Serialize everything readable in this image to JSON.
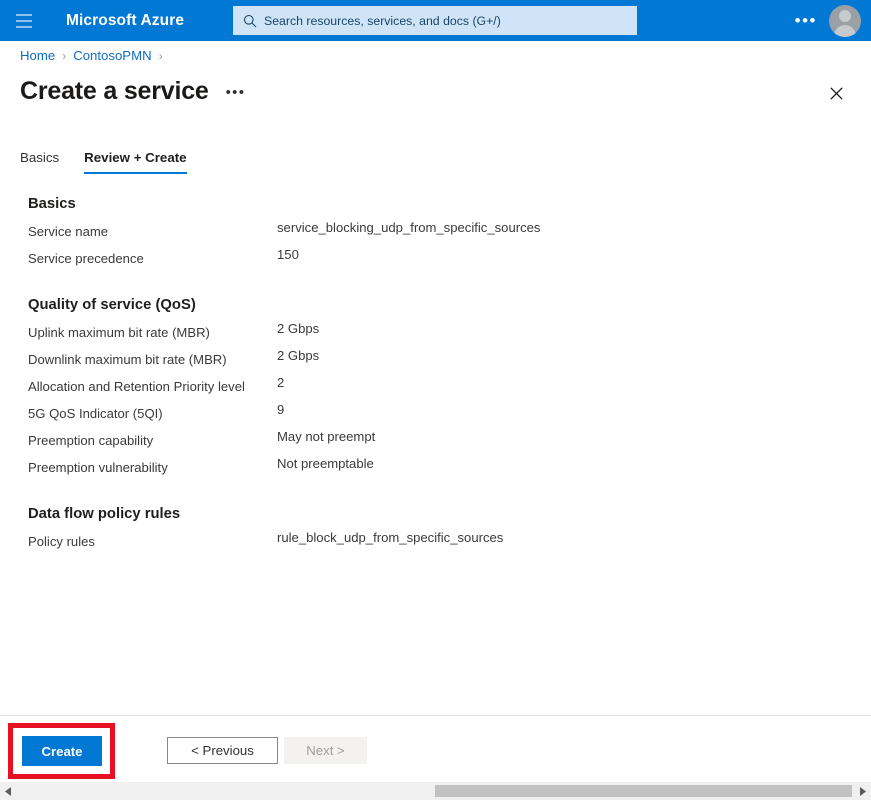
{
  "topbar": {
    "menu_icon": "hamburger-icon",
    "brand": "Microsoft Azure",
    "search": {
      "icon": "search-icon",
      "placeholder": "Search resources, services, and docs (G+/)",
      "value": ""
    },
    "more_label": "•••",
    "avatar_icon": "user-avatar-icon",
    "accent_color": "#0078d4",
    "search_bg_color": "#cfe4f7"
  },
  "breadcrumb": {
    "items": [
      {
        "label": "Home"
      },
      {
        "label": "ContosoPMN"
      }
    ],
    "separator": "›",
    "link_color": "#0f6cbd"
  },
  "header": {
    "title": "Create a service",
    "more_label": "•••",
    "close_icon": "close-icon"
  },
  "tabs": [
    {
      "label": "Basics",
      "active": false
    },
    {
      "label": "Review + Create",
      "active": true
    }
  ],
  "sections": [
    {
      "title": "Basics",
      "rows": [
        {
          "label": "Service name",
          "value": "service_blocking_udp_from_specific_sources"
        },
        {
          "label": "Service precedence",
          "value": "150"
        }
      ]
    },
    {
      "title": "Quality of service (QoS)",
      "rows": [
        {
          "label": "Uplink maximum bit rate (MBR)",
          "value": "2 Gbps"
        },
        {
          "label": "Downlink maximum bit rate (MBR)",
          "value": "2 Gbps"
        },
        {
          "label": "Allocation and Retention Priority level",
          "value": "2"
        },
        {
          "label": "5G QoS Indicator (5QI)",
          "value": "9"
        },
        {
          "label": "Preemption capability",
          "value": "May not preempt"
        },
        {
          "label": "Preemption vulnerability",
          "value": "Not preemptable"
        }
      ]
    },
    {
      "title": "Data flow policy rules",
      "rows": [
        {
          "label": "Policy rules",
          "value": "rule_block_udp_from_specific_sources"
        }
      ]
    }
  ],
  "footer": {
    "create_label": "Create",
    "previous_label": "< Previous",
    "next_label": "Next >",
    "next_disabled": true,
    "highlight_color": "#e81123"
  },
  "scrollbar": {
    "left_arrow_icon": "chevron-left-icon",
    "right_arrow_icon": "chevron-right-icon"
  }
}
